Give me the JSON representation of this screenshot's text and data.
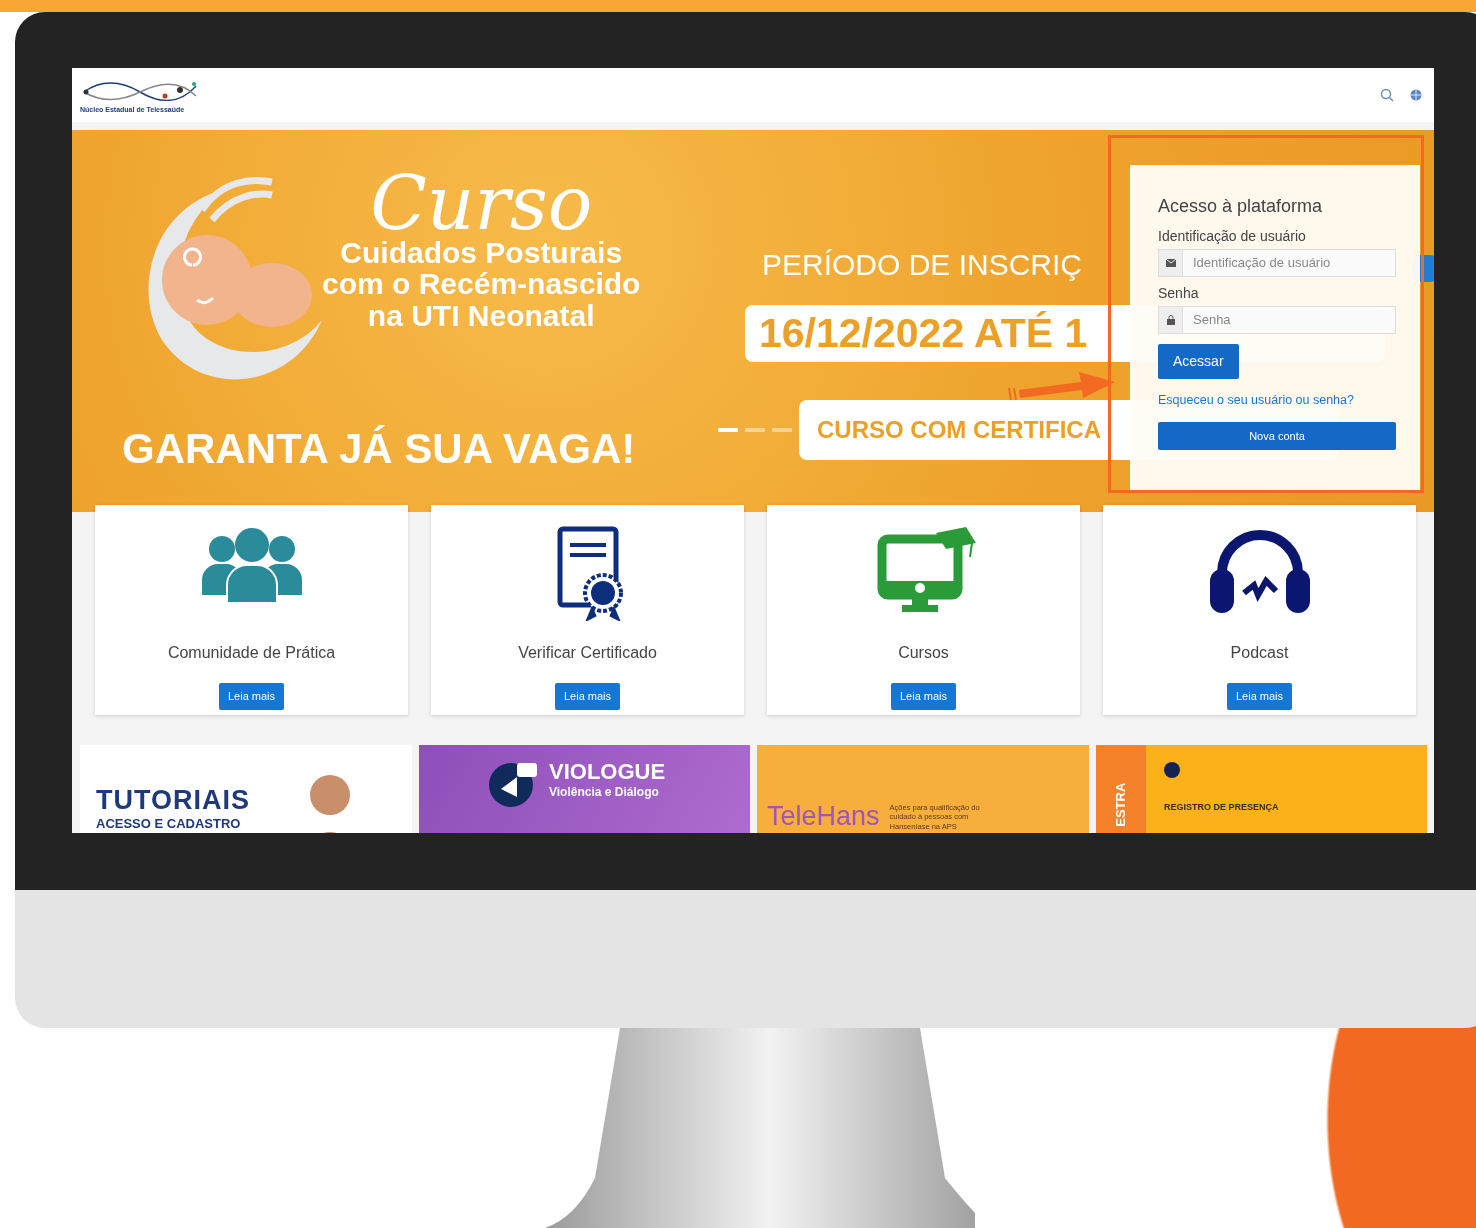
{
  "header": {
    "logo_text": "Núcleo Estadual de Telessaúde"
  },
  "banner": {
    "script_title": "Curso",
    "subtitle_lines": [
      "Cuidados Posturais",
      "com o Recém-nascido",
      "na UTI Neonatal"
    ],
    "cta": "GARANTA JÁ SUA VAGA!",
    "period_label": "PERÍODO DE INSCRIÇ",
    "dates": "16/12/2022 ATÉ 1",
    "certificate": "CURSO COM CERTIFICA",
    "indicators": [
      {
        "selected": true
      },
      {
        "selected": false
      },
      {
        "selected": false
      }
    ]
  },
  "login": {
    "title": "Acesso à plataforma",
    "username_label": "Identificação de usuário",
    "username_placeholder": "Identificação de usuário",
    "password_label": "Senha",
    "password_placeholder": "Senha",
    "submit": "Acessar",
    "forgot_link": "Esqueceu o seu usuário ou senha?",
    "new_account": "Nova conta"
  },
  "features": [
    {
      "kind": "people",
      "title": "Comunidade de Prática",
      "button": "Leia mais"
    },
    {
      "kind": "certificate",
      "title": "Verificar Certificado",
      "button": "Leia mais"
    },
    {
      "kind": "computer",
      "title": "Cursos",
      "button": "Leia mais"
    },
    {
      "kind": "headphones",
      "title": "Podcast",
      "button": "Leia mais"
    }
  ],
  "tiles": [
    {
      "kind": "tutorials",
      "texts": [
        "TUTORIAIS",
        "ACESSO E CADASTRO"
      ]
    },
    {
      "kind": "viologue",
      "texts": [
        "VIOLOGUE",
        "Violência e Diálogo"
      ]
    },
    {
      "kind": "telehans",
      "texts": [
        "TeleHans",
        "Ações para qualificação do cuidado à pessoas com Hanseníase na APS"
      ]
    },
    {
      "kind": "registro",
      "texts": [
        "ESTRA",
        "REGISTRO DE PRESENÇA"
      ]
    }
  ]
}
